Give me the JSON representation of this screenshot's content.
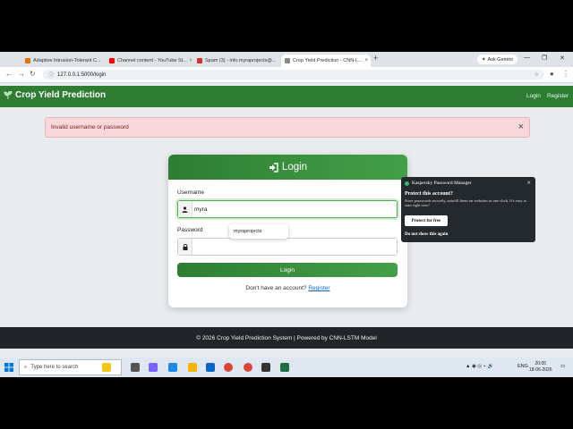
{
  "browser": {
    "tabs": [
      {
        "label": "Adaptive Intrusion-Tolerant C...",
        "color": "#e8710a"
      },
      {
        "label": "Channel content - YouTube St...",
        "color": "#ff0000"
      },
      {
        "label": "Spam (3) - info.myraprojects@...",
        "color": "#d93025"
      },
      {
        "label": "Crop Yield Prediction - CNN-L...",
        "color": "#888888"
      }
    ],
    "new_tab": "+",
    "gemini": "Ask Gemini",
    "url": "127.0.0.1:5000/login"
  },
  "app": {
    "brand": "Crop Yield Prediction",
    "nav": {
      "login": "Login",
      "register": "Register"
    },
    "alert": "Invalid username or password",
    "alert_close": "×",
    "card_title": "Login",
    "username_label": "Username",
    "username_value": "myra",
    "password_label": "Password",
    "password_value": "",
    "autofill_suggestion": "myraprojects",
    "login_button": "Login",
    "signup_prompt": "Don't have an account?",
    "signup_link": "Register",
    "footer": "© 2026 Crop Yield Prediction System | Powered by CNN-LSTM Model"
  },
  "kaspersky": {
    "title": "Kaspersky Password Manager",
    "question": "Protect this account?",
    "description": "Store passwords securely, autofill them on websites in one click. It's easy to start right now!",
    "button": "Protect for free",
    "dismiss": "Do not show this again"
  },
  "taskbar": {
    "search_placeholder": "Type here to search",
    "language": "ENG",
    "time": "20:05",
    "date": "18-06-2026"
  }
}
